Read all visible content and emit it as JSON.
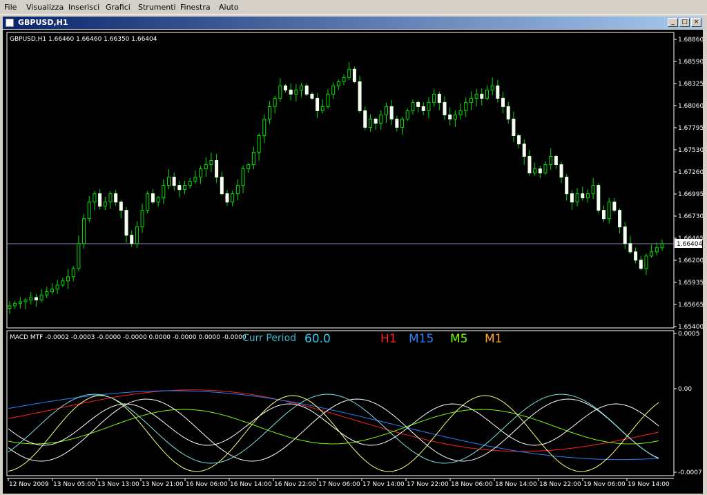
{
  "menu": [
    "File",
    "Visualizza",
    "Inserisci",
    "Grafici",
    "Strumenti",
    "Finestra",
    "Aiuto"
  ],
  "window": {
    "title": "GBPUSD,H1",
    "minimize": "_",
    "restore": "□",
    "close": "×"
  },
  "price_chart": {
    "header": "GBPUSD,H1  1.66460 1.66460 1.66350 1.66404",
    "current_price": "1.66404",
    "y_ticks": [
      "1.68860",
      "1.68590",
      "1.68325",
      "1.68060",
      "1.67795",
      "1.67530",
      "1.67260",
      "1.66995",
      "1.66730",
      "1.66465",
      "1.66200",
      "1.65935",
      "1.65665",
      "1.65400"
    ]
  },
  "indicator": {
    "header": "MACD MTF -0.0002 -0.0003 -0.0000 -0.0000 0.0000 -0.0000 0.0000 -0.0000",
    "curr_period_label": "Curr Period",
    "curr_period_value": "60.0",
    "timeframes": [
      {
        "label": "H1",
        "color": "#ff2020"
      },
      {
        "label": "M15",
        "color": "#2a7fff"
      },
      {
        "label": "M5",
        "color": "#7cfc00"
      },
      {
        "label": "M1",
        "color": "#ffa020"
      }
    ],
    "y_ticks": [
      "0.0005",
      "0.00",
      "-0.0007"
    ]
  },
  "x_axis": [
    "12 Nov 2009",
    "13 Nov 05:00",
    "13 Nov 13:00",
    "13 Nov 21:00",
    "16 Nov 06:00",
    "16 Nov 14:00",
    "16 Nov 22:00",
    "17 Nov 06:00",
    "17 Nov 14:00",
    "17 Nov 22:00",
    "18 Nov 06:00",
    "18 Nov 14:00",
    "18 Nov 22:00",
    "19 Nov 06:00",
    "19 Nov 14:00"
  ],
  "chart_data": {
    "type": "candlestick",
    "symbol": "GBPUSD",
    "timeframe": "H1",
    "ylim": [
      1.654,
      1.6886
    ],
    "closes": [
      1.6565,
      1.6568,
      1.657,
      1.6572,
      1.6575,
      1.6572,
      1.6578,
      1.6582,
      1.6585,
      1.659,
      1.6595,
      1.66,
      1.661,
      1.664,
      1.667,
      1.669,
      1.67,
      1.6685,
      1.669,
      1.67,
      1.669,
      1.668,
      1.665,
      1.664,
      1.666,
      1.668,
      1.67,
      1.669,
      1.6695,
      1.671,
      1.672,
      1.671,
      1.6705,
      1.671,
      1.6715,
      1.672,
      1.673,
      1.6735,
      1.674,
      1.672,
      1.67,
      1.669,
      1.67,
      1.671,
      1.673,
      1.6735,
      1.675,
      1.677,
      1.679,
      1.6805,
      1.6815,
      1.683,
      1.6825,
      1.682,
      1.6825,
      1.683,
      1.682,
      1.6815,
      1.68,
      1.6805,
      1.682,
      1.683,
      1.6835,
      1.684,
      1.685,
      1.6835,
      1.68,
      1.678,
      1.679,
      1.6785,
      1.6795,
      1.6805,
      1.679,
      1.678,
      1.679,
      1.68,
      1.681,
      1.6805,
      1.68,
      1.681,
      1.682,
      1.681,
      1.6795,
      1.679,
      1.6795,
      1.68,
      1.681,
      1.6815,
      1.682,
      1.6815,
      1.6825,
      1.683,
      1.6815,
      1.6805,
      1.679,
      1.677,
      1.676,
      1.6745,
      1.6725,
      1.673,
      1.6725,
      1.6735,
      1.6745,
      1.6735,
      1.672,
      1.67,
      1.669,
      1.67,
      1.6695,
      1.67,
      1.671,
      1.668,
      1.667,
      1.669,
      1.668,
      1.666,
      1.664,
      1.663,
      1.662,
      1.661,
      1.6625,
      1.663,
      1.6635,
      1.664
    ]
  }
}
